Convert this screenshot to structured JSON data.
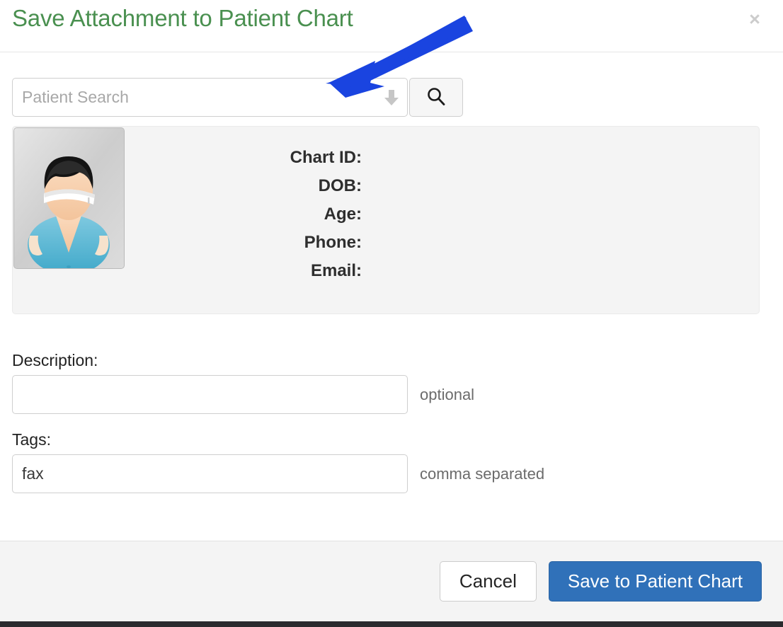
{
  "dialog": {
    "title": "Save Attachment to Patient Chart",
    "close_label": "×",
    "close_icon": "close-icon",
    "accent_green": "#4a9050",
    "accent_blue": "#3071b9"
  },
  "search": {
    "placeholder": "Patient Search",
    "value": "",
    "dropdown_icon": "chevron-down-icon",
    "search_icon": "search-icon",
    "button_label": ""
  },
  "patient": {
    "avatar_icon": "patient-avatar-icon",
    "fields": [
      {
        "label": "Chart ID:",
        "value": ""
      },
      {
        "label": "DOB:",
        "value": ""
      },
      {
        "label": "Age:",
        "value": ""
      },
      {
        "label": "Phone:",
        "value": ""
      },
      {
        "label": "Email:",
        "value": ""
      }
    ]
  },
  "form": {
    "description": {
      "label": "Description:",
      "value": "",
      "placeholder": "",
      "hint": "optional"
    },
    "tags": {
      "label": "Tags:",
      "value": "fax",
      "placeholder": "",
      "hint": "comma separated"
    }
  },
  "footer": {
    "cancel_label": "Cancel",
    "save_label": "Save to Patient Chart"
  },
  "annotation": {
    "arrow_color": "#1a44e0",
    "arrow_target": "patient-search-input"
  }
}
